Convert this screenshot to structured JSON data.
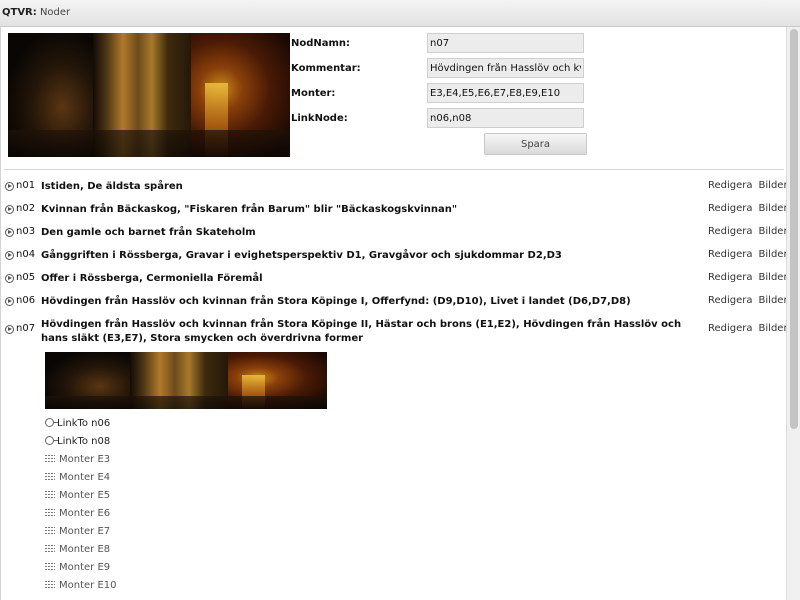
{
  "window": {
    "app": "QTVR:",
    "section": "Noder"
  },
  "form": {
    "fields": [
      {
        "label": "NodNamn:",
        "value": "n07"
      },
      {
        "label": "Kommentar:",
        "value": "Hövdingen från Hasslöv och kvinnan från Stora Köpinge II"
      },
      {
        "label": "Monter:",
        "value": "E3,E4,E5,E6,E7,E8,E9,E10"
      },
      {
        "label": "LinkNode:",
        "value": "n06,n08"
      }
    ],
    "save_label": "Spara"
  },
  "actions": {
    "edit": "Redigera",
    "images": "Bilder"
  },
  "nodes": [
    {
      "id": "n01",
      "title": "Istiden, De äldsta spåren"
    },
    {
      "id": "n02",
      "title": "Kvinnan från Bäckaskog, \"Fiskaren från Barum\" blir \"Bäckaskogskvinnan\""
    },
    {
      "id": "n03",
      "title": "Den gamle och barnet från Skateholm"
    },
    {
      "id": "n04",
      "title": "Gånggriften i Rössberga, Gravar i evighetsperspektiv D1, Gravgåvor och sjukdommar D2,D3"
    },
    {
      "id": "n05",
      "title": "Offer i Rössberga, Cermoniella Föremål"
    },
    {
      "id": "n06",
      "title": "Hövdingen från Hasslöv och kvinnan från Stora Köpinge I, Offerfynd: (D9,D10), Livet i landet (D6,D7,D8)"
    },
    {
      "id": "n07",
      "title": "Hövdingen från Hasslöv och kvinnan från Stora Köpinge II, Hästar och brons (E1,E2), Hövdingen från Hasslöv och hans släkt (E3,E7), Stora smycken och överdrivna former"
    }
  ],
  "expanded": {
    "links": [
      "LinkTo n06",
      "LinkTo n08"
    ],
    "monters": [
      "Monter E3",
      "Monter E4",
      "Monter E5",
      "Monter E6",
      "Monter E7",
      "Monter E8",
      "Monter E9",
      "Monter E10"
    ]
  },
  "colors": {
    "accent": "#f0c040",
    "background": "#ffffff",
    "chrome": "#e9e9e9"
  }
}
